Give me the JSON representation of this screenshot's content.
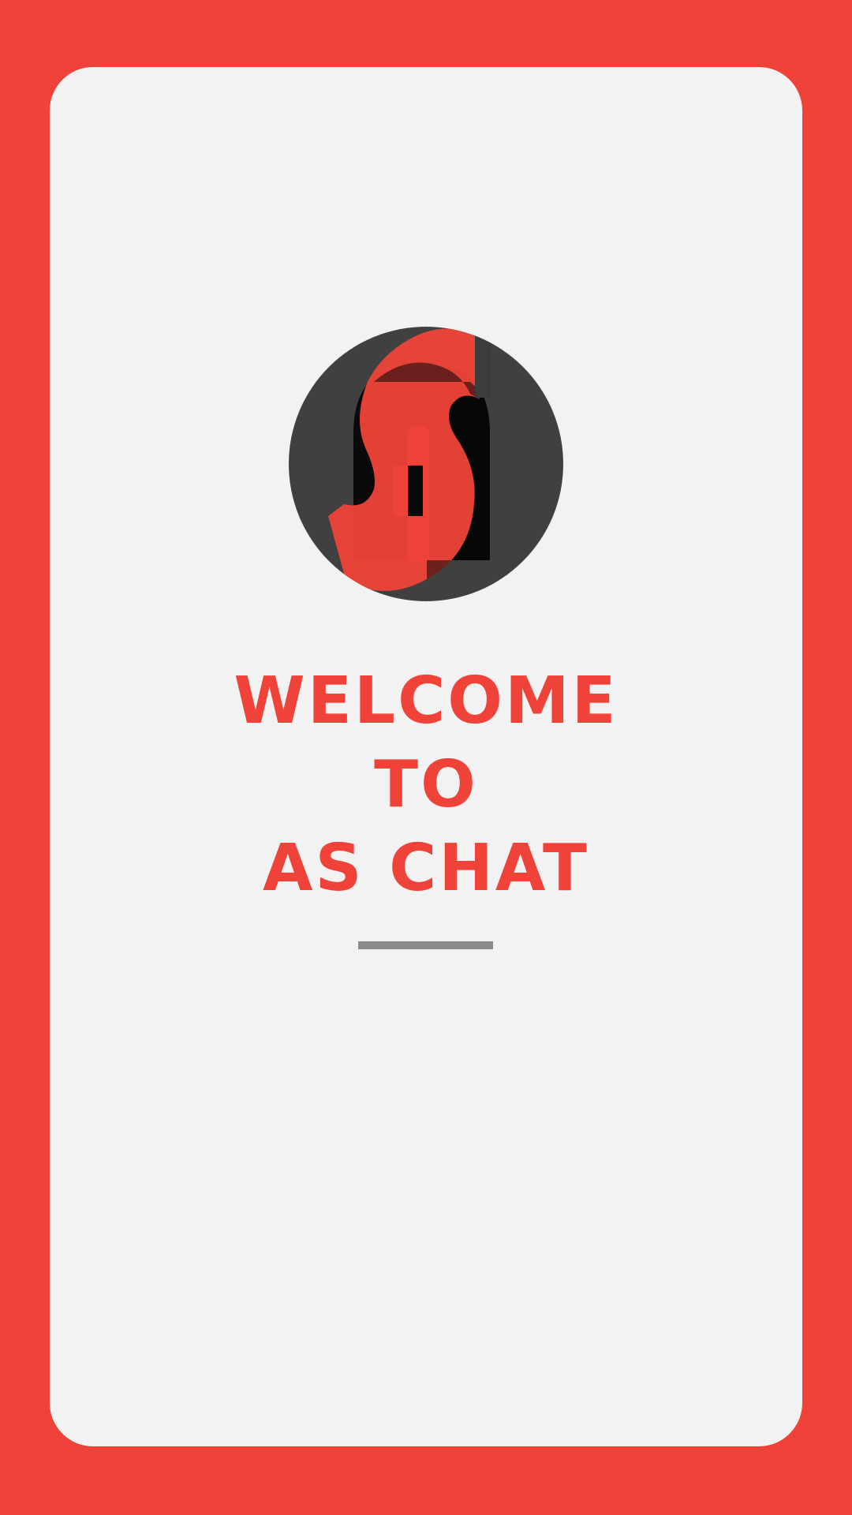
{
  "app": {
    "name": "AS CHAT"
  },
  "splash": {
    "logo_icon": "as-chat-logo-icon",
    "welcome_lines": [
      "WELCOME",
      "TO",
      "AS CHAT"
    ]
  },
  "colors": {
    "background": "#ef4339",
    "card": "#f3f2f3",
    "logo_circle": "#404040",
    "accent": "#ef4339",
    "divider": "#8a8a8a"
  }
}
